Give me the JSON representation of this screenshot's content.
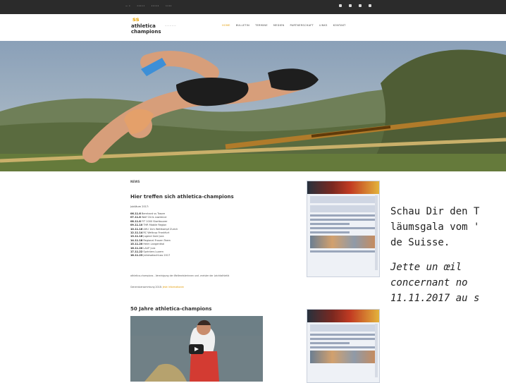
{
  "top_bar": {
    "links": [
      "— •",
      "•••••",
      "•••••",
      "••••"
    ]
  },
  "nav": {
    "logo_top": "ss",
    "logo_bottom": "athletica champions",
    "menu": [
      "HOME",
      "BULLETIN",
      "TERMINE",
      "MEDIEN",
      "PARTNERSCHAFT",
      "LINKS",
      "KONTAKT"
    ]
  },
  "main": {
    "news_label": "NEWS",
    "news_title": "Hier treffen sich athletica-champions",
    "news_sub": "Jubiläum 2017:",
    "schedule": [
      {
        "date": "06.11.6",
        "text": "Bernhard vs Traore"
      },
      {
        "date": "07.11.8",
        "text": "Wolf Chris Lawrence"
      },
      {
        "date": "08.11.8",
        "text": "FIT 1000 Startbuzzer"
      },
      {
        "date": "09.11.10",
        "text": "THR Mobile Region"
      },
      {
        "date": "10.11.16",
        "text": "AHU 1km Wettkampf Zurich"
      },
      {
        "date": "12.11.14",
        "text": "RC Weltcup Frankfurt"
      },
      {
        "date": "13.11.16",
        "text": "Jugend Gold Jura"
      },
      {
        "date": "14.11.18",
        "text": "Regional Frauen Team"
      },
      {
        "date": "15.11.20",
        "text": "Heim Langenthal"
      },
      {
        "date": "16.11.20",
        "text": "LAUF Jura"
      },
      {
        "date": "17.11.22",
        "text": "Sprinters Luzern"
      },
      {
        "date": "18.11.23",
        "text": "Jahresabschluss 2017"
      }
    ],
    "note": "athletica-champions - Vereinigung der Weltmeisterinnen und -meister der Leichtathletik",
    "note2_prefix": "Generalversammlung 2018: ",
    "note2_link": "Jetzt Informationen",
    "video_title": "50 Jahre athletica-champions"
  },
  "promo": {
    "de_lines": [
      "Schau Dir den T",
      "läumsgala vom '",
      "de Suisse."
    ],
    "fr_lines": [
      "Jette  un  œil",
      "concernant  no",
      "11.11.2017 au s"
    ]
  },
  "colors": {
    "accent": "#e29a00",
    "topbar": "#2b2b2b",
    "facebook_header_dark": "#27313d",
    "facebook_header_red": "#c23b22"
  }
}
